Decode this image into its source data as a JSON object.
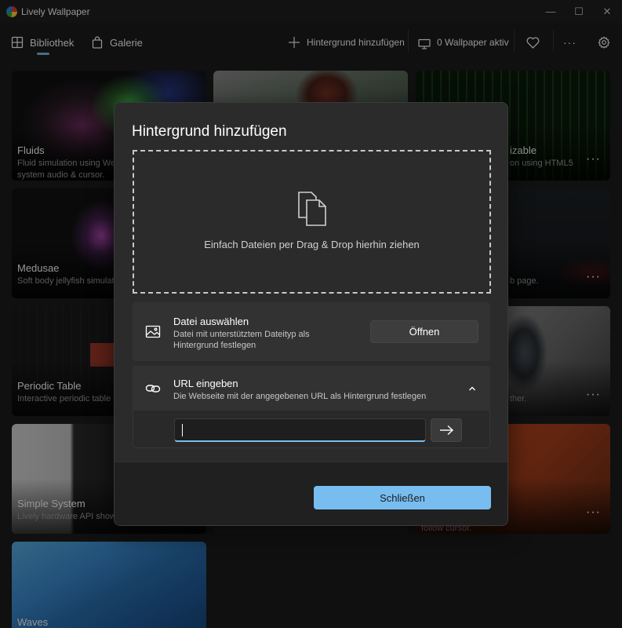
{
  "window": {
    "title": "Lively Wallpaper",
    "controls": {
      "minimize": "—",
      "maximize": "☐",
      "close": "✕"
    }
  },
  "nav": {
    "tabs": [
      {
        "label": "Bibliothek",
        "icon": "grid-icon",
        "selected": true
      },
      {
        "label": "Galerie",
        "icon": "shopping-bag-icon",
        "selected": false
      }
    ],
    "add_wallpaper": "Hintergrund hinzufügen",
    "active_wallpapers": "0 Wallpaper aktiv",
    "more": "···"
  },
  "library": [
    {
      "title": "Fluids",
      "desc": "Fluid simulation using We\nsystem audio & cursor."
    },
    {
      "title": "",
      "desc": ""
    },
    {
      "title": "izable",
      "desc": "on using HTML5"
    },
    {
      "title": "Medusae",
      "desc": "Soft body jellyfish simulat"
    },
    {
      "title": "",
      "desc": ""
    },
    {
      "title": "",
      "desc": "b page."
    },
    {
      "title": "Periodic Table",
      "desc": "Interactive periodic table"
    },
    {
      "title": "",
      "desc": ""
    },
    {
      "title": "",
      "desc": "ther."
    },
    {
      "title": "Simple System",
      "desc": "Lively hardware API show"
    },
    {
      "title": "",
      "desc": ""
    },
    {
      "title": "",
      "desc": "ator with light that\nfollow cursor."
    },
    {
      "title": "Waves",
      "desc": ""
    }
  ],
  "dialog": {
    "title": "Hintergrund hinzufügen",
    "dropzone_text": "Einfach Dateien per Drag & Drop hierhin ziehen",
    "file_section": {
      "title": "Datei auswählen",
      "desc_line1": "Datei mit unterstütztem Dateityp als",
      "desc_line2": "Hintergrund festlegen",
      "button": "Öffnen"
    },
    "url_section": {
      "title": "URL eingeben",
      "desc": "Die Webseite mit der angegebenen URL als Hintergrund festlegen",
      "input_value": ""
    },
    "close_button": "Schließen"
  },
  "colors": {
    "accent": "#78bdf0",
    "background": "#1c1c1c",
    "dialog": "#2b2b2b",
    "section": "#323232"
  }
}
